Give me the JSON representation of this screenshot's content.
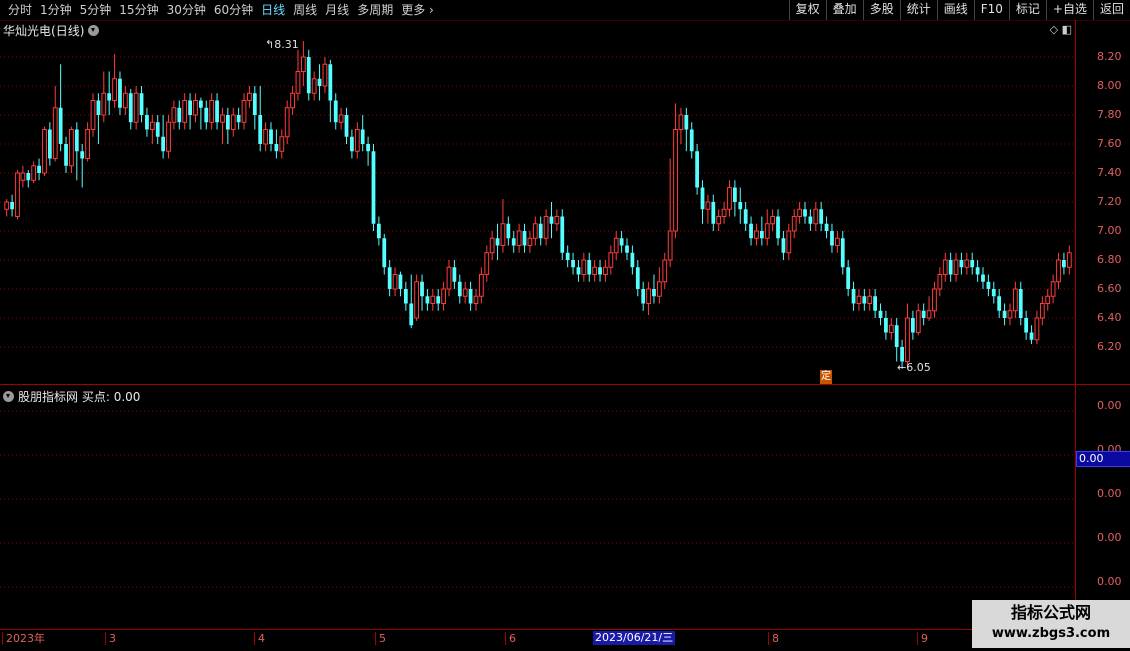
{
  "toolbar": {
    "periods": [
      "分时",
      "1分钟",
      "5分钟",
      "15分钟",
      "30分钟",
      "60分钟",
      "日线",
      "周线",
      "月线",
      "多周期",
      "更多"
    ],
    "active_period": "日线",
    "buttons": [
      "复权",
      "叠加",
      "多股",
      "统计",
      "画线",
      "F10",
      "标记",
      "+自选",
      "返回"
    ]
  },
  "stock": {
    "name": "华灿光电",
    "period_label": "(日线)"
  },
  "indicator": {
    "name": "股朋指标网",
    "label": "买点:",
    "value": "0.00"
  },
  "price_axis": [
    "8.20",
    "8.00",
    "7.80",
    "7.60",
    "7.40",
    "7.20",
    "7.00",
    "6.80",
    "6.60",
    "6.40",
    "6.20"
  ],
  "indicator_axis": [
    "0.00",
    "0.00",
    "0.00",
    "0.00",
    "0.00"
  ],
  "current_value": "0.00",
  "markers": {
    "high": "8.31",
    "low": "6.05",
    "ding": "定"
  },
  "date_axis": {
    "ticks": [
      "2023年",
      "3",
      "4",
      "5",
      "6",
      "7",
      "8",
      "9"
    ],
    "cursor": "2023/06/21/三"
  },
  "watermark": {
    "title": "指标公式网",
    "url": "www.zbgs3.com"
  },
  "colors": {
    "up": "#ff3c3c",
    "down": "#54ffff",
    "grid": "#8b0000",
    "background": "#000000"
  },
  "chart_data": {
    "type": "candlestick",
    "ylim": [
      6.0,
      8.35
    ],
    "candles": [
      [
        7.15,
        7.2,
        7.1,
        7.22
      ],
      [
        7.2,
        7.15,
        7.1,
        7.25
      ],
      [
        7.1,
        7.4,
        7.08,
        7.42
      ],
      [
        7.35,
        7.4,
        7.3,
        7.45
      ],
      [
        7.4,
        7.35,
        7.3,
        7.42
      ],
      [
        7.35,
        7.45,
        7.33,
        7.48
      ],
      [
        7.45,
        7.4,
        7.35,
        7.5
      ],
      [
        7.4,
        7.7,
        7.38,
        7.72
      ],
      [
        7.7,
        7.5,
        7.45,
        7.75
      ],
      [
        7.5,
        7.85,
        7.48,
        8.0
      ],
      [
        7.85,
        7.6,
        7.55,
        8.15
      ],
      [
        7.6,
        7.45,
        7.4,
        7.65
      ],
      [
        7.45,
        7.7,
        7.4,
        7.72
      ],
      [
        7.7,
        7.55,
        7.35,
        7.75
      ],
      [
        7.55,
        7.5,
        7.3,
        7.6
      ],
      [
        7.5,
        7.7,
        7.48,
        7.75
      ],
      [
        7.7,
        7.9,
        7.65,
        7.95
      ],
      [
        7.9,
        7.8,
        7.6,
        7.95
      ],
      [
        7.8,
        7.95,
        7.75,
        8.1
      ],
      [
        7.95,
        7.9,
        7.8,
        8.1
      ],
      [
        7.9,
        8.05,
        7.85,
        8.22
      ],
      [
        8.05,
        7.85,
        7.8,
        8.1
      ],
      [
        7.85,
        7.95,
        7.8,
        8.0
      ],
      [
        7.95,
        7.75,
        7.7,
        7.98
      ],
      [
        7.75,
        7.95,
        7.7,
        8.0
      ],
      [
        7.95,
        7.8,
        7.75,
        8.0
      ],
      [
        7.8,
        7.7,
        7.65,
        7.85
      ],
      [
        7.7,
        7.75,
        7.6,
        7.8
      ],
      [
        7.75,
        7.65,
        7.6,
        7.8
      ],
      [
        7.65,
        7.55,
        7.5,
        7.8
      ],
      [
        7.55,
        7.75,
        7.5,
        7.8
      ],
      [
        7.75,
        7.85,
        7.7,
        7.9
      ],
      [
        7.85,
        7.75,
        7.7,
        7.9
      ],
      [
        7.75,
        7.9,
        7.7,
        7.95
      ],
      [
        7.9,
        7.8,
        7.7,
        7.95
      ],
      [
        7.8,
        7.9,
        7.75,
        7.95
      ],
      [
        7.9,
        7.85,
        7.7,
        7.92
      ],
      [
        7.85,
        7.75,
        7.7,
        7.9
      ],
      [
        7.75,
        7.9,
        7.7,
        7.95
      ],
      [
        7.9,
        7.75,
        7.7,
        7.95
      ],
      [
        7.75,
        7.8,
        7.6,
        7.85
      ],
      [
        7.8,
        7.7,
        7.6,
        7.85
      ],
      [
        7.7,
        7.8,
        7.65,
        7.85
      ],
      [
        7.8,
        7.75,
        7.7,
        7.85
      ],
      [
        7.75,
        7.9,
        7.7,
        7.95
      ],
      [
        7.9,
        7.95,
        7.85,
        8.0
      ],
      [
        7.95,
        7.8,
        7.7,
        8.0
      ],
      [
        7.8,
        7.6,
        7.55,
        8.0
      ],
      [
        7.6,
        7.7,
        7.55,
        7.75
      ],
      [
        7.7,
        7.6,
        7.55,
        7.75
      ],
      [
        7.6,
        7.55,
        7.5,
        7.7
      ],
      [
        7.55,
        7.65,
        7.5,
        7.7
      ],
      [
        7.65,
        7.85,
        7.6,
        7.9
      ],
      [
        7.85,
        7.95,
        7.8,
        8.0
      ],
      [
        7.95,
        8.1,
        7.9,
        8.25
      ],
      [
        8.1,
        8.2,
        8.0,
        8.31
      ],
      [
        8.2,
        7.95,
        7.9,
        8.25
      ],
      [
        7.95,
        8.05,
        7.9,
        8.1
      ],
      [
        8.05,
        8.0,
        7.9,
        8.15
      ],
      [
        8.0,
        8.15,
        7.95,
        8.2
      ],
      [
        8.15,
        7.9,
        7.75,
        8.18
      ],
      [
        7.9,
        7.75,
        7.7,
        7.95
      ],
      [
        7.75,
        7.8,
        7.7,
        7.85
      ],
      [
        7.8,
        7.65,
        7.6,
        7.85
      ],
      [
        7.65,
        7.55,
        7.5,
        7.7
      ],
      [
        7.55,
        7.7,
        7.5,
        7.75
      ],
      [
        7.7,
        7.6,
        7.55,
        7.8
      ],
      [
        7.6,
        7.55,
        7.45,
        7.65
      ],
      [
        7.55,
        7.05,
        7.0,
        7.6
      ],
      [
        7.05,
        6.95,
        6.9,
        7.1
      ],
      [
        6.95,
        6.75,
        6.7,
        6.98
      ],
      [
        6.75,
        6.6,
        6.55,
        6.8
      ],
      [
        6.6,
        6.7,
        6.55,
        6.75
      ],
      [
        6.7,
        6.6,
        6.55,
        6.72
      ],
      [
        6.6,
        6.5,
        6.45,
        6.65
      ],
      [
        6.5,
        6.35,
        6.33,
        6.7
      ],
      [
        6.4,
        6.65,
        6.38,
        6.7
      ],
      [
        6.65,
        6.55,
        6.45,
        6.7
      ],
      [
        6.55,
        6.5,
        6.45,
        6.6
      ],
      [
        6.5,
        6.55,
        6.45,
        6.6
      ],
      [
        6.55,
        6.5,
        6.45,
        6.6
      ],
      [
        6.5,
        6.6,
        6.45,
        6.65
      ],
      [
        6.6,
        6.75,
        6.55,
        6.8
      ],
      [
        6.75,
        6.65,
        6.6,
        6.8
      ],
      [
        6.65,
        6.55,
        6.5,
        6.7
      ],
      [
        6.55,
        6.6,
        6.5,
        6.65
      ],
      [
        6.6,
        6.5,
        6.45,
        6.65
      ],
      [
        6.5,
        6.55,
        6.45,
        6.6
      ],
      [
        6.55,
        6.7,
        6.5,
        6.75
      ],
      [
        6.7,
        6.85,
        6.65,
        6.9
      ],
      [
        6.85,
        6.95,
        6.8,
        7.0
      ],
      [
        6.95,
        6.9,
        6.8,
        7.05
      ],
      [
        6.9,
        7.05,
        6.85,
        7.22
      ],
      [
        7.05,
        6.95,
        6.9,
        7.1
      ],
      [
        6.95,
        6.9,
        6.85,
        7.0
      ],
      [
        6.9,
        7.0,
        6.85,
        7.05
      ],
      [
        7.0,
        6.9,
        6.85,
        7.05
      ],
      [
        6.9,
        6.95,
        6.85,
        7.0
      ],
      [
        6.95,
        7.05,
        6.9,
        7.1
      ],
      [
        7.05,
        6.95,
        6.9,
        7.1
      ],
      [
        6.95,
        7.1,
        6.9,
        7.15
      ],
      [
        7.1,
        7.05,
        6.95,
        7.2
      ],
      [
        7.05,
        7.1,
        7.0,
        7.15
      ],
      [
        7.1,
        6.85,
        6.8,
        7.15
      ],
      [
        6.85,
        6.8,
        6.75,
        6.9
      ],
      [
        6.8,
        6.75,
        6.7,
        6.85
      ],
      [
        6.75,
        6.7,
        6.65,
        6.8
      ],
      [
        6.7,
        6.8,
        6.65,
        6.85
      ],
      [
        6.8,
        6.7,
        6.65,
        6.85
      ],
      [
        6.7,
        6.75,
        6.65,
        6.8
      ],
      [
        6.75,
        6.7,
        6.65,
        6.8
      ],
      [
        6.7,
        6.75,
        6.65,
        6.8
      ],
      [
        6.75,
        6.85,
        6.7,
        6.9
      ],
      [
        6.85,
        6.95,
        6.8,
        7.0
      ],
      [
        6.95,
        6.9,
        6.85,
        7.0
      ],
      [
        6.9,
        6.85,
        6.8,
        6.95
      ],
      [
        6.85,
        6.75,
        6.7,
        6.9
      ],
      [
        6.75,
        6.6,
        6.55,
        6.8
      ],
      [
        6.6,
        6.5,
        6.45,
        6.65
      ],
      [
        6.5,
        6.6,
        6.42,
        6.65
      ],
      [
        6.6,
        6.55,
        6.5,
        6.7
      ],
      [
        6.55,
        6.65,
        6.5,
        6.75
      ],
      [
        6.65,
        6.8,
        6.6,
        6.85
      ],
      [
        6.8,
        7.0,
        6.75,
        7.5
      ],
      [
        7.0,
        7.7,
        6.95,
        7.88
      ],
      [
        7.7,
        7.8,
        7.6,
        7.85
      ],
      [
        7.8,
        7.7,
        7.55,
        7.85
      ],
      [
        7.7,
        7.55,
        7.5,
        7.75
      ],
      [
        7.55,
        7.3,
        7.25,
        7.6
      ],
      [
        7.3,
        7.15,
        7.05,
        7.35
      ],
      [
        7.15,
        7.2,
        7.05,
        7.25
      ],
      [
        7.2,
        7.05,
        7.0,
        7.25
      ],
      [
        7.05,
        7.1,
        7.0,
        7.15
      ],
      [
        7.1,
        7.15,
        7.05,
        7.2
      ],
      [
        7.15,
        7.3,
        7.1,
        7.35
      ],
      [
        7.3,
        7.2,
        7.1,
        7.35
      ],
      [
        7.2,
        7.15,
        7.05,
        7.3
      ],
      [
        7.15,
        7.05,
        7.0,
        7.2
      ],
      [
        7.05,
        6.95,
        6.9,
        7.1
      ],
      [
        6.95,
        7.0,
        6.9,
        7.05
      ],
      [
        7.0,
        6.95,
        6.9,
        7.1
      ],
      [
        6.95,
        7.05,
        6.9,
        7.15
      ],
      [
        7.05,
        7.1,
        7.0,
        7.15
      ],
      [
        7.1,
        6.95,
        6.9,
        7.15
      ],
      [
        6.95,
        6.85,
        6.8,
        7.0
      ],
      [
        6.85,
        7.0,
        6.8,
        7.05
      ],
      [
        7.0,
        7.1,
        6.95,
        7.15
      ],
      [
        7.1,
        7.15,
        7.05,
        7.2
      ],
      [
        7.15,
        7.1,
        7.05,
        7.2
      ],
      [
        7.1,
        7.05,
        7.0,
        7.15
      ],
      [
        7.05,
        7.15,
        7.0,
        7.2
      ],
      [
        7.15,
        7.05,
        7.0,
        7.2
      ],
      [
        7.05,
        7.0,
        6.95,
        7.1
      ],
      [
        7.0,
        6.9,
        6.85,
        7.05
      ],
      [
        6.9,
        6.95,
        6.85,
        7.0
      ],
      [
        6.95,
        6.75,
        6.7,
        7.0
      ],
      [
        6.75,
        6.6,
        6.55,
        6.8
      ],
      [
        6.6,
        6.5,
        6.45,
        6.65
      ],
      [
        6.5,
        6.55,
        6.45,
        6.6
      ],
      [
        6.55,
        6.5,
        6.45,
        6.6
      ],
      [
        6.5,
        6.55,
        6.45,
        6.6
      ],
      [
        6.55,
        6.45,
        6.4,
        6.6
      ],
      [
        6.45,
        6.4,
        6.35,
        6.5
      ],
      [
        6.4,
        6.3,
        6.25,
        6.45
      ],
      [
        6.3,
        6.35,
        6.25,
        6.4
      ],
      [
        6.35,
        6.2,
        6.1,
        6.4
      ],
      [
        6.2,
        6.1,
        6.05,
        6.25
      ],
      [
        6.1,
        6.4,
        6.05,
        6.5
      ],
      [
        6.4,
        6.3,
        6.25,
        6.45
      ],
      [
        6.3,
        6.45,
        6.28,
        6.5
      ],
      [
        6.45,
        6.4,
        6.35,
        6.5
      ],
      [
        6.4,
        6.45,
        6.38,
        6.55
      ],
      [
        6.45,
        6.6,
        6.4,
        6.65
      ],
      [
        6.6,
        6.7,
        6.55,
        6.75
      ],
      [
        6.7,
        6.8,
        6.65,
        6.85
      ],
      [
        6.8,
        6.7,
        6.65,
        6.85
      ],
      [
        6.7,
        6.8,
        6.65,
        6.85
      ],
      [
        6.8,
        6.75,
        6.7,
        6.85
      ],
      [
        6.75,
        6.8,
        6.7,
        6.85
      ],
      [
        6.8,
        6.75,
        6.7,
        6.85
      ],
      [
        6.75,
        6.7,
        6.65,
        6.8
      ],
      [
        6.7,
        6.65,
        6.6,
        6.75
      ],
      [
        6.65,
        6.6,
        6.55,
        6.7
      ],
      [
        6.6,
        6.55,
        6.5,
        6.65
      ],
      [
        6.55,
        6.45,
        6.4,
        6.6
      ],
      [
        6.45,
        6.4,
        6.35,
        6.5
      ],
      [
        6.4,
        6.45,
        6.35,
        6.5
      ],
      [
        6.45,
        6.6,
        6.4,
        6.65
      ],
      [
        6.6,
        6.4,
        6.35,
        6.65
      ],
      [
        6.4,
        6.3,
        6.25,
        6.45
      ],
      [
        6.3,
        6.25,
        6.22,
        6.35
      ],
      [
        6.25,
        6.4,
        6.22,
        6.45
      ],
      [
        6.4,
        6.5,
        6.35,
        6.55
      ],
      [
        6.5,
        6.55,
        6.45,
        6.6
      ],
      [
        6.55,
        6.65,
        6.5,
        6.7
      ],
      [
        6.65,
        6.8,
        6.6,
        6.85
      ],
      [
        6.8,
        6.75,
        6.7,
        6.85
      ],
      [
        6.75,
        6.85,
        6.7,
        6.9
      ]
    ]
  }
}
